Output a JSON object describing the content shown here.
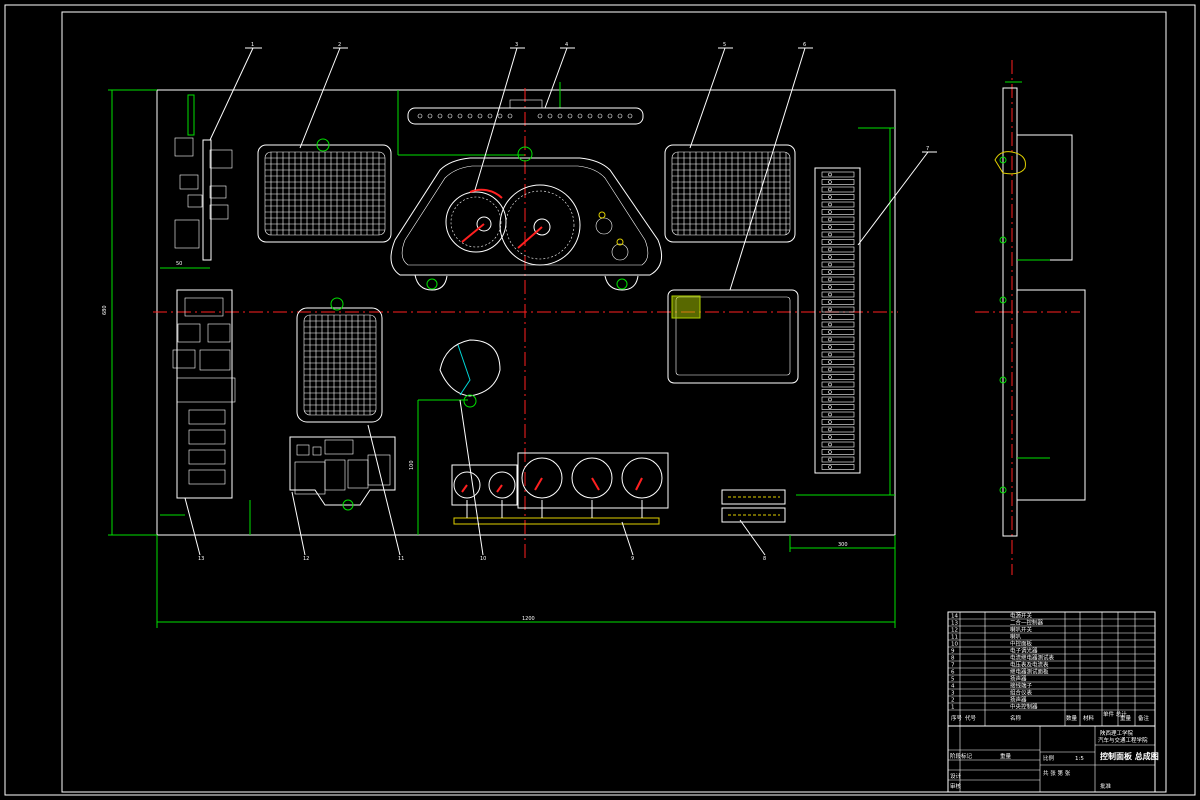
{
  "drawing": {
    "title": "控制面板 总成图",
    "school_line_1": "陕西理工学院",
    "school_line_2": "汽车与交通工程学院"
  },
  "balloons": [
    "1",
    "2",
    "3",
    "4",
    "5",
    "6",
    "7",
    "8",
    "9",
    "10",
    "11",
    "12",
    "13",
    "14"
  ],
  "dimensions": {
    "overall_width": "1200",
    "overall_height": "680",
    "right_margin": "300",
    "bottom_offset": "100",
    "left_small": "50"
  },
  "parts_list": [
    {
      "no": "14",
      "name": "电源开关"
    },
    {
      "no": "13",
      "name": "二合一控制器"
    },
    {
      "no": "12",
      "name": "喇叭开关"
    },
    {
      "no": "11",
      "name": "喇叭"
    },
    {
      "no": "10",
      "name": "中控面板"
    },
    {
      "no": "9",
      "name": "电子调光器"
    },
    {
      "no": "8",
      "name": "电流继电器测试表"
    },
    {
      "no": "7",
      "name": "电压表及电流表"
    },
    {
      "no": "6",
      "name": "继电器测试面板"
    },
    {
      "no": "5",
      "name": "扬声器"
    },
    {
      "no": "4",
      "name": "接线端子"
    },
    {
      "no": "3",
      "name": "组合仪表"
    },
    {
      "no": "2",
      "name": "扬声器"
    },
    {
      "no": "1",
      "name": "中央控制器"
    }
  ],
  "table_headers": [
    "序号",
    "代号",
    "名称",
    "数量",
    "材料",
    "单件 总计",
    "重量",
    "备注"
  ],
  "title_block": {
    "scale": "比例",
    "sheet": "共 张 第 张",
    "design": "设计",
    "check": "审核",
    "approve": "批准",
    "stage": "阶段标记",
    "weight": "重量",
    "ratio": "1:5"
  },
  "colors": {
    "frame": "#ffffff",
    "dimension": "#00e000",
    "centerline": "#ff2020",
    "hidden": "#00d8d8",
    "highlight": "#e0d000"
  }
}
